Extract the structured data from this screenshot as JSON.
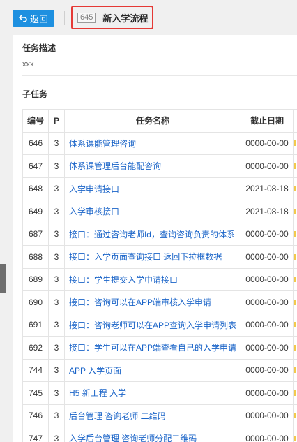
{
  "header": {
    "back_label": "返回",
    "task_id": "645",
    "task_title": "新入学流程"
  },
  "description": {
    "title": "任务描述",
    "value": "xxx"
  },
  "subtasks": {
    "title": "子任务",
    "columns": [
      "编号",
      "P",
      "任务名称",
      "截止日期"
    ],
    "rows": [
      {
        "id": "646",
        "p": "3",
        "name": "体系课能管理咨询",
        "date": "0000-00-00"
      },
      {
        "id": "647",
        "p": "3",
        "name": "体系课管理后台能配咨询",
        "date": "0000-00-00"
      },
      {
        "id": "648",
        "p": "3",
        "name": "入学申请接口",
        "date": "2021-08-18"
      },
      {
        "id": "649",
        "p": "3",
        "name": "入学审核接口",
        "date": "2021-08-18"
      },
      {
        "id": "687",
        "p": "3",
        "name": "接口：通过咨询老师Id，查询咨询负责的体系",
        "date": "0000-00-00"
      },
      {
        "id": "688",
        "p": "3",
        "name": "接口：入学页面查询接口 返回下拉框数据",
        "date": "0000-00-00"
      },
      {
        "id": "689",
        "p": "3",
        "name": "接口：学生提交入学申请接口",
        "date": "0000-00-00"
      },
      {
        "id": "690",
        "p": "3",
        "name": "接口：咨询可以在APP端审核入学申请",
        "date": "0000-00-00"
      },
      {
        "id": "691",
        "p": "3",
        "name": "接口：咨询老师可以在APP查询入学申请列表",
        "date": "0000-00-00"
      },
      {
        "id": "692",
        "p": "3",
        "name": "接口：学生可以在APP端查看自己的入学申请",
        "date": "0000-00-00"
      },
      {
        "id": "744",
        "p": "3",
        "name": "APP 入学页面",
        "date": "0000-00-00"
      },
      {
        "id": "745",
        "p": "3",
        "name": "H5 新工程 入学",
        "date": "0000-00-00"
      },
      {
        "id": "746",
        "p": "3",
        "name": "后台管理 咨询老师 二维码",
        "date": "0000-00-00"
      },
      {
        "id": "747",
        "p": "3",
        "name": "入学后台管理 咨询老师分配二维码",
        "date": "0000-00-00"
      }
    ]
  }
}
